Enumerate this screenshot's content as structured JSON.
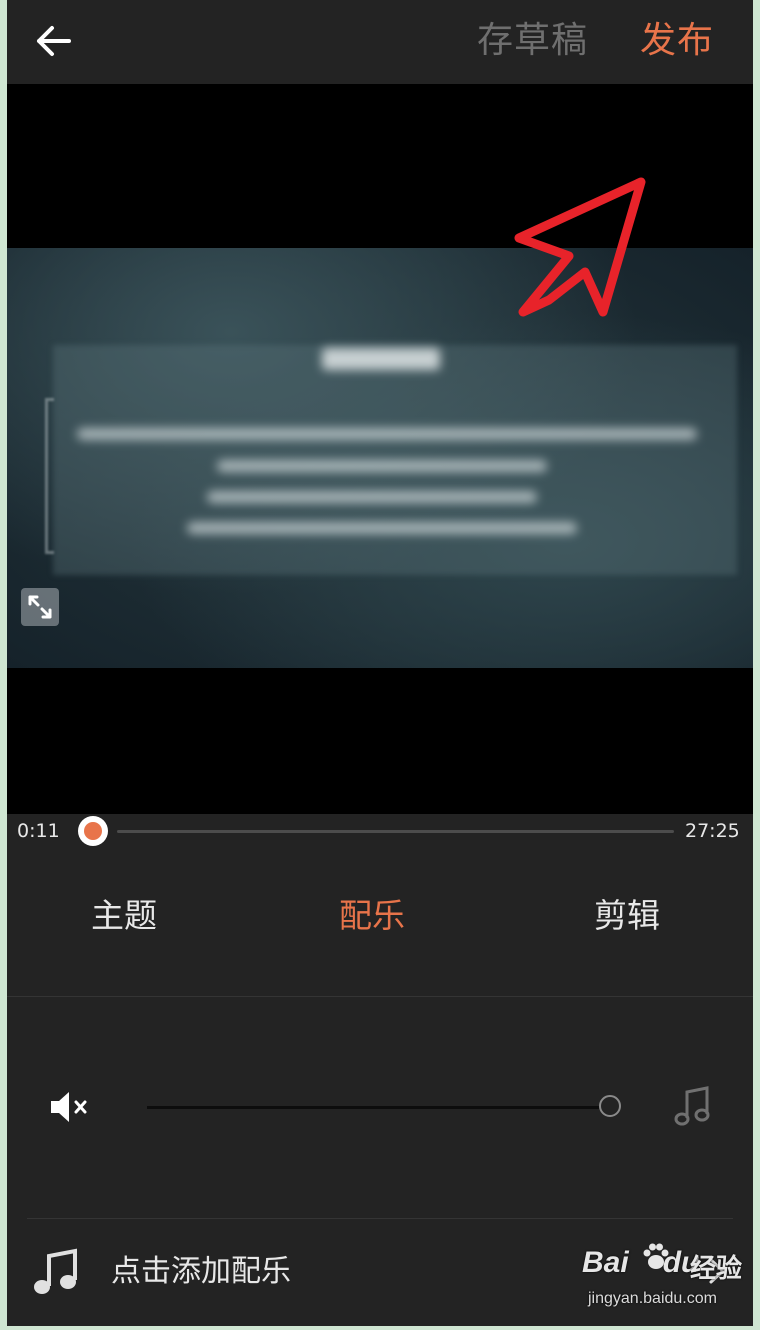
{
  "topbar": {
    "back_icon": "arrow-left-icon",
    "draft_label": "存草稿",
    "publish_label": "发布"
  },
  "annotation": {
    "icon": "red-cursor-arrow-icon",
    "color": "#e8232a"
  },
  "player": {
    "current_time": "0:11",
    "total_time": "27:25",
    "expand_icon": "expand-icon",
    "progress": 0.007
  },
  "tabs": [
    {
      "label": "主题",
      "active": false
    },
    {
      "label": "配乐",
      "active": true
    },
    {
      "label": "剪辑",
      "active": false
    }
  ],
  "volume": {
    "mute_icon": "volume-mute-icon",
    "music_icon": "music-note-icon",
    "level": 1.0
  },
  "add_music": {
    "icon": "music-note-icon",
    "label": "点击添加配乐",
    "chevron_icon": "chevron-right-icon"
  },
  "watermark": {
    "brand": "Bai",
    "brand_suffix": "du",
    "product": "经验",
    "url": "jingyan.baidu.com"
  },
  "colors": {
    "accent": "#e8744a",
    "background": "#232323",
    "text": "#e8e8e8",
    "muted": "#6f6f6f"
  }
}
